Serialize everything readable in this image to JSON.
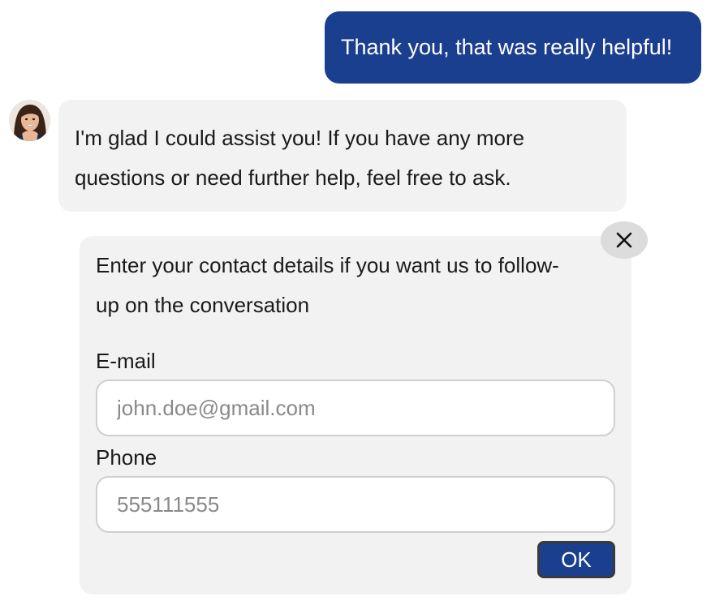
{
  "messages": {
    "user": {
      "text": "Thank you, that was really helpful!"
    },
    "bot": {
      "avatar_icon": "agent-avatar",
      "lines": [
        "I'm glad I could assist you! If you have any more",
        "questions or need further help, feel free to ask."
      ]
    }
  },
  "contact_form": {
    "close_icon": "close-icon",
    "intro_lines": [
      "Enter your contact details if you want us to follow-",
      "up on the conversation"
    ],
    "email": {
      "label": "E-mail",
      "placeholder": "john.doe@gmail.com",
      "value": ""
    },
    "phone": {
      "label": "Phone",
      "placeholder": "555111555",
      "value": ""
    },
    "ok_label": "OK"
  },
  "colors": {
    "accent": "#1b3f8f",
    "bubble_background": "#f2f2f2",
    "close_button_background": "#dcdcdc"
  }
}
